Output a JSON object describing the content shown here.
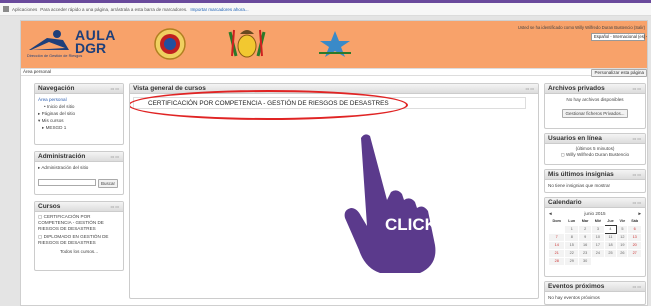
{
  "browser": {
    "bookmarks_label": "Aplicaciones",
    "bookmarks_hint": "Para acceder rápido a una página, arrástrala a esta barra de marcadores.",
    "import_link": "Importar marcadores ahora..."
  },
  "header": {
    "logo_line1": "AULA",
    "logo_line2": "DGR",
    "logo_sub": "Dirección de Gestión de Riesgos",
    "login_text": "Usted se ha identificado como Willy Wilfredo Duran Bustencio (Salir)",
    "language": "Español - Internacional (es) ▾"
  },
  "navbar": {
    "breadcrumb": "Área personal",
    "customize": "Personalizar esta página"
  },
  "navigation": {
    "title": "Navegación",
    "items": [
      "Área personal",
      "Inicio del sitio",
      "Páginas del sitio",
      "Mis cursos",
      "MESGD 1"
    ]
  },
  "administration": {
    "title": "Administración",
    "item": "Administración del sitio",
    "search_button": "Buscar"
  },
  "courses": {
    "title": "Cursos",
    "items": [
      "CERTIFICACIÓN POR COMPETENCIA - GESTIÓN DE RIESGOS DE DESASTRES",
      "DIPLOMADO EN GESTIÓN DE RIESGOS DE DESASTRES"
    ],
    "all_courses": "Todos los cursos..."
  },
  "main": {
    "title": "Vista general de cursos",
    "course": "CERTIFICACIÓN POR COMPETENCIA - GESTIÓN DE RIESGOS DE DESASTRES"
  },
  "private_files": {
    "title": "Archivos privados",
    "empty": "No hay archivos disponibles",
    "manage": "Gestionar ficheros Privados..."
  },
  "online_users": {
    "title": "Usuarios en línea",
    "period": "(últimos 5 minutos)",
    "user": "Willy Wilfredo Duran Bustencio"
  },
  "badges": {
    "title": "Mis últimos insignias",
    "empty": "No tiene insignias que mostrar"
  },
  "calendar": {
    "title": "Calendario",
    "month": "junio 2015",
    "prev": "◄",
    "next": "►",
    "days": [
      "Dom",
      "Lun",
      "Mar",
      "Mié",
      "Jue",
      "Vie",
      "Sáb"
    ],
    "weeks": [
      [
        "",
        "1",
        "2",
        "3",
        "4",
        "5",
        "6"
      ],
      [
        "7",
        "8",
        "9",
        "10",
        "11",
        "12",
        "13"
      ],
      [
        "14",
        "15",
        "16",
        "17",
        "18",
        "19",
        "20"
      ],
      [
        "21",
        "22",
        "23",
        "24",
        "25",
        "26",
        "27"
      ],
      [
        "28",
        "29",
        "30",
        "",
        "",
        "",
        ""
      ]
    ]
  },
  "events": {
    "title": "Eventos próximos",
    "empty": "No hay eventos próximos"
  },
  "overlay": {
    "click_label": "CLICK",
    "hand_color": "#5b3a8c",
    "accent_red": "#e02424",
    "header_orange": "#f8a26a"
  }
}
